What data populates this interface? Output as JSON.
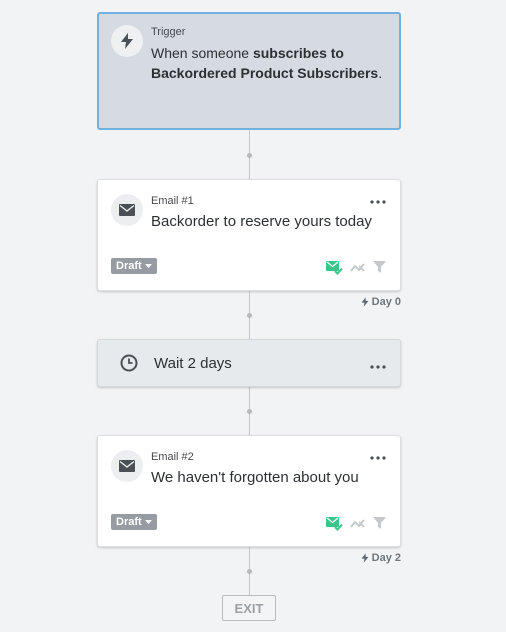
{
  "trigger": {
    "label": "Trigger",
    "text_prefix": "When someone ",
    "text_bold": "subscribes to Backordered Product Subscribers",
    "text_suffix": ".",
    "icon": "lightning-icon"
  },
  "steps": [
    {
      "type": "email",
      "label": "Email #1",
      "subject": "Backorder to reserve yours today",
      "status": "Draft",
      "day_label": "Day 0"
    },
    {
      "type": "wait",
      "text": "Wait 2 days"
    },
    {
      "type": "email",
      "label": "Email #2",
      "subject": "We haven't forgotten about you",
      "status": "Draft",
      "day_label": "Day 2"
    }
  ],
  "exit_label": "EXIT",
  "colors": {
    "trigger_border": "#6fb1e0",
    "trigger_bg": "#d6dbe2",
    "smart_send_green": "#3cc48a",
    "draft_badge": "#969ca1"
  }
}
